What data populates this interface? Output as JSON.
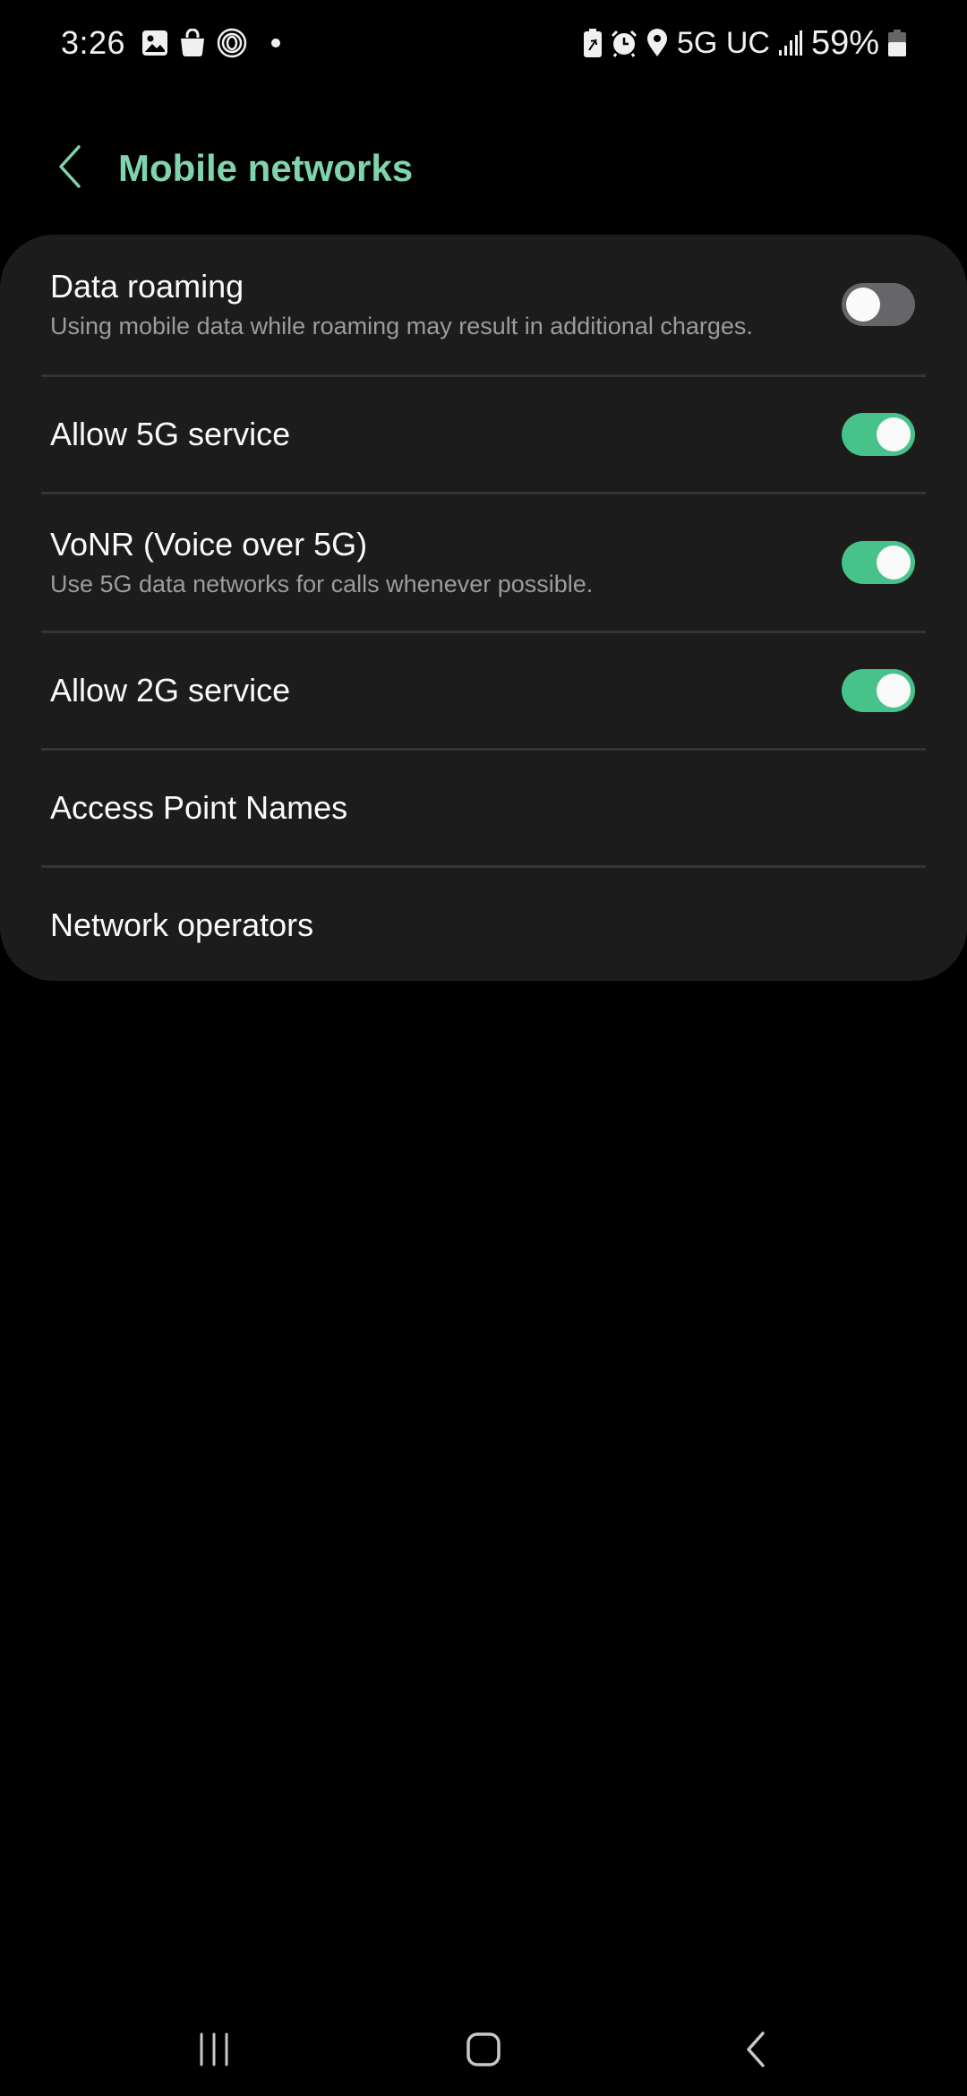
{
  "status_bar": {
    "time": "3:26",
    "left_icons": [
      "gallery-icon",
      "shopping-bag-icon",
      "fingerprint-spiral-icon",
      "notification-dot-icon"
    ],
    "right_icons": [
      "battery-saver-icon",
      "alarm-icon",
      "location-icon"
    ],
    "network_type": "5G UC",
    "signal_icon": "signal-bars-icon",
    "battery_percent": "59%",
    "battery_level": 0.59
  },
  "header": {
    "back_icon": "chevron-left-icon",
    "title": "Mobile networks"
  },
  "settings": [
    {
      "id": "data-roaming",
      "title": "Data roaming",
      "subtitle": "Using mobile data while roaming may result in additional charges.",
      "toggle": "off"
    },
    {
      "id": "allow-5g",
      "title": "Allow 5G service",
      "subtitle": "",
      "toggle": "on"
    },
    {
      "id": "vonr",
      "title": "VoNR (Voice over 5G)",
      "subtitle": "Use 5G data networks for calls whenever possible.",
      "toggle": "on"
    },
    {
      "id": "allow-2g",
      "title": "Allow 2G service",
      "subtitle": "",
      "toggle": "on"
    },
    {
      "id": "apn",
      "title": "Access Point Names",
      "subtitle": "",
      "toggle": null
    },
    {
      "id": "network-operators",
      "title": "Network operators",
      "subtitle": "",
      "toggle": null
    }
  ],
  "colors": {
    "accent": "#7fd4ab",
    "toggle_on": "#46c28a",
    "toggle_off": "#666569",
    "card_bg": "#1c1c1c",
    "background": "#000000"
  },
  "nav_bar": {
    "buttons": [
      "recent-apps-icon",
      "home-icon",
      "back-icon"
    ]
  }
}
